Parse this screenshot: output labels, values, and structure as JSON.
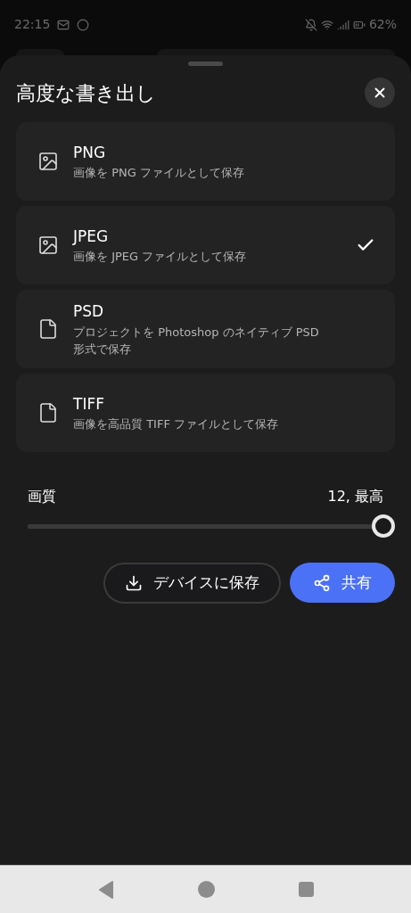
{
  "status_bar": {
    "time": "22:15",
    "battery": "62%"
  },
  "sheet": {
    "title": "高度な書き出し"
  },
  "formats": [
    {
      "kind": "image",
      "name": "PNG",
      "description": "画像を PNG ファイルとして保存",
      "selected": false
    },
    {
      "kind": "image",
      "name": "JPEG",
      "description": "画像を JPEG ファイルとして保存",
      "selected": true
    },
    {
      "kind": "file",
      "name": "PSD",
      "description": "プロジェクトを Photoshop のネイティブ PSD 形式で保存",
      "selected": false
    },
    {
      "kind": "file",
      "name": "TIFF",
      "description": "画像を高品質 TIFF ファイルとして保存",
      "selected": false
    }
  ],
  "quality": {
    "label": "画質",
    "reading": "12, 最高",
    "level": 1
  },
  "buttons": {
    "save": "デバイスに保存",
    "share": "共有"
  }
}
